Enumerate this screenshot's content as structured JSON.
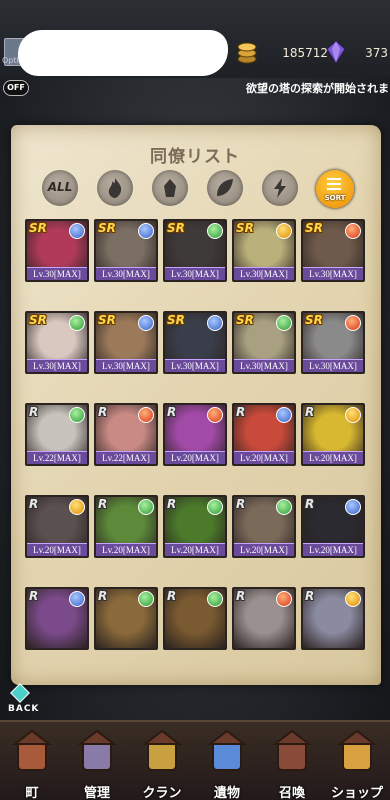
{
  "currency": {
    "gold": "185712",
    "gems": "373"
  },
  "header": {
    "options_label": "Option",
    "toggle_label": "OFF",
    "ticker": "欲望の塔の探索が開始されました"
  },
  "panel": {
    "title": "同僚リスト",
    "filter_all": "ALL",
    "sort_label": "SORT"
  },
  "filters": [
    "all",
    "fire",
    "earth",
    "wind",
    "thunder"
  ],
  "cards": [
    {
      "rarity": "SR",
      "element": "water",
      "level": "Lv.30[MAX]",
      "color": "#b13a5a"
    },
    {
      "rarity": "SR",
      "element": "water",
      "level": "Lv.30[MAX]",
      "color": "#7b6e62"
    },
    {
      "rarity": "SR",
      "element": "wind",
      "level": "Lv.30[MAX]",
      "color": "#3f3a3a"
    },
    {
      "rarity": "SR",
      "element": "thunder",
      "level": "Lv.30[MAX]",
      "color": "#b9b07a"
    },
    {
      "rarity": "SR",
      "element": "fire",
      "level": "Lv.30[MAX]",
      "color": "#6e5a4a"
    },
    {
      "rarity": "SR",
      "element": "wind",
      "level": "Lv.30[MAX]",
      "color": "#d8c8c0"
    },
    {
      "rarity": "SR",
      "element": "water",
      "level": "Lv.30[MAX]",
      "color": "#9b7a5a"
    },
    {
      "rarity": "SR",
      "element": "water",
      "level": "Lv.30[MAX]",
      "color": "#3a3e4a"
    },
    {
      "rarity": "SR",
      "element": "wind",
      "level": "Lv.30[MAX]",
      "color": "#a8a080"
    },
    {
      "rarity": "SR",
      "element": "fire",
      "level": "Lv.30[MAX]",
      "color": "#8a8a8a"
    },
    {
      "rarity": "R",
      "element": "wind",
      "level": "Lv.22[MAX]",
      "color": "#c9c3bd"
    },
    {
      "rarity": "R",
      "element": "fire",
      "level": "Lv.22[MAX]",
      "color": "#c98a84"
    },
    {
      "rarity": "R",
      "element": "fire",
      "level": "Lv.20[MAX]",
      "color": "#a24aa8"
    },
    {
      "rarity": "R",
      "element": "water",
      "level": "Lv.20[MAX]",
      "color": "#c84a3a"
    },
    {
      "rarity": "R",
      "element": "thunder",
      "level": "Lv.20[MAX]",
      "color": "#d8b830"
    },
    {
      "rarity": "R",
      "element": "thunder",
      "level": "Lv.20[MAX]",
      "color": "#5a5050"
    },
    {
      "rarity": "R",
      "element": "wind",
      "level": "Lv.20[MAX]",
      "color": "#5c8a3a"
    },
    {
      "rarity": "R",
      "element": "wind",
      "level": "Lv.20[MAX]",
      "color": "#4a7a2a"
    },
    {
      "rarity": "R",
      "element": "wind",
      "level": "Lv.20[MAX]",
      "color": "#7a6a5a"
    },
    {
      "rarity": "R",
      "element": "water",
      "level": "Lv.20[MAX]",
      "color": "#2a2a30"
    },
    {
      "rarity": "R",
      "element": "water",
      "level": "",
      "color": "#7a4a8a"
    },
    {
      "rarity": "R",
      "element": "wind",
      "level": "",
      "color": "#8a6a3a"
    },
    {
      "rarity": "R",
      "element": "wind",
      "level": "",
      "color": "#7a5a30"
    },
    {
      "rarity": "R",
      "element": "fire",
      "level": "",
      "color": "#9a9090"
    },
    {
      "rarity": "R",
      "element": "thunder",
      "level": "",
      "color": "#8a8aa0"
    }
  ],
  "back_label": "BACK",
  "nav": [
    {
      "label": "町",
      "icon": "town-icon"
    },
    {
      "label": "管理",
      "icon": "management-icon"
    },
    {
      "label": "クラン",
      "icon": "clan-icon"
    },
    {
      "label": "遺物",
      "icon": "relic-icon"
    },
    {
      "label": "召喚",
      "icon": "summon-icon"
    },
    {
      "label": "ショップ",
      "icon": "shop-icon"
    }
  ]
}
